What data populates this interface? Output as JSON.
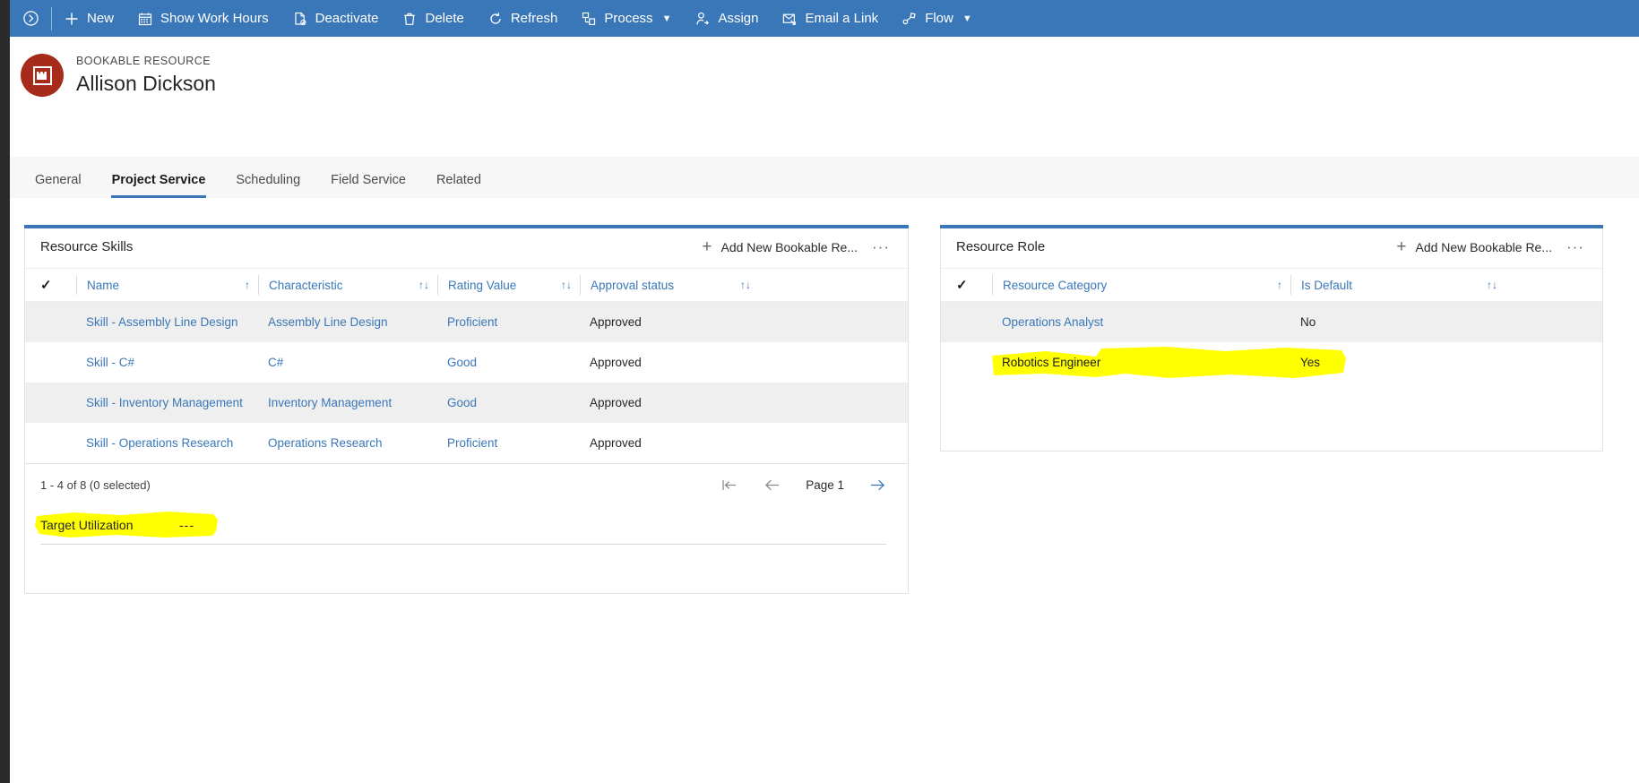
{
  "colors": {
    "command_bar": "#3a77b8",
    "accent": "#3a77b8",
    "avatar": "#a62b1b",
    "highlight": "#ffff00",
    "link": "#3a77b8"
  },
  "command_bar": {
    "overflow_icon": "circle-chevron-right-icon",
    "items": [
      {
        "label": "New",
        "icon": "plus-icon",
        "chevron": false
      },
      {
        "label": "Show Work Hours",
        "icon": "calendar-icon",
        "chevron": false
      },
      {
        "label": "Deactivate",
        "icon": "deactivate-page-icon",
        "chevron": false
      },
      {
        "label": "Delete",
        "icon": "trash-icon",
        "chevron": false
      },
      {
        "label": "Refresh",
        "icon": "refresh-icon",
        "chevron": false
      },
      {
        "label": "Process",
        "icon": "process-icon",
        "chevron": true
      },
      {
        "label": "Assign",
        "icon": "assign-person-icon",
        "chevron": false
      },
      {
        "label": "Email a Link",
        "icon": "email-link-icon",
        "chevron": false
      },
      {
        "label": "Flow",
        "icon": "flow-icon",
        "chevron": true
      }
    ]
  },
  "record_header": {
    "entity_label": "BOOKABLE RESOURCE",
    "record_name": "Allison Dickson",
    "avatar_icon": "bookable-resource-icon"
  },
  "tabs": [
    {
      "label": "General",
      "active": false
    },
    {
      "label": "Project Service",
      "active": true
    },
    {
      "label": "Scheduling",
      "active": false
    },
    {
      "label": "Field Service",
      "active": false
    },
    {
      "label": "Related",
      "active": false
    }
  ],
  "resource_skills": {
    "title": "Resource Skills",
    "add_label": "Add New Bookable Re...",
    "more_label": "···",
    "columns": [
      {
        "label": "Name",
        "sort": "↑"
      },
      {
        "label": "Characteristic",
        "sort": "↑↓"
      },
      {
        "label": "Rating Value",
        "sort": "↑↓"
      },
      {
        "label": "Approval status",
        "sort": "↑↓"
      }
    ],
    "rows": [
      {
        "name": "Skill - Assembly Line Design",
        "characteristic": "Assembly Line Design",
        "rating": "Proficient",
        "approval": "Approved"
      },
      {
        "name": "Skill - C#",
        "characteristic": "C#",
        "rating": "Good",
        "approval": "Approved"
      },
      {
        "name": "Skill - Inventory Management",
        "characteristic": "Inventory Management",
        "rating": "Good",
        "approval": "Approved"
      },
      {
        "name": "Skill - Operations Research",
        "characteristic": "Operations Research",
        "rating": "Proficient",
        "approval": "Approved"
      }
    ],
    "footer_count": "1 - 4 of 8 (0 selected)",
    "page_label": "Page 1"
  },
  "target_utilization": {
    "label": "Target Utilization",
    "value": "---",
    "highlighted": true
  },
  "resource_role": {
    "title": "Resource Role",
    "add_label": "Add New Bookable Re...",
    "more_label": "···",
    "columns": [
      {
        "label": "Resource Category",
        "sort": "↑"
      },
      {
        "label": "Is Default",
        "sort": "↑↓"
      }
    ],
    "rows": [
      {
        "category": "Operations Analyst",
        "is_default": "No",
        "highlighted": false
      },
      {
        "category": "Robotics Engineer",
        "is_default": "Yes",
        "highlighted": true
      }
    ]
  }
}
